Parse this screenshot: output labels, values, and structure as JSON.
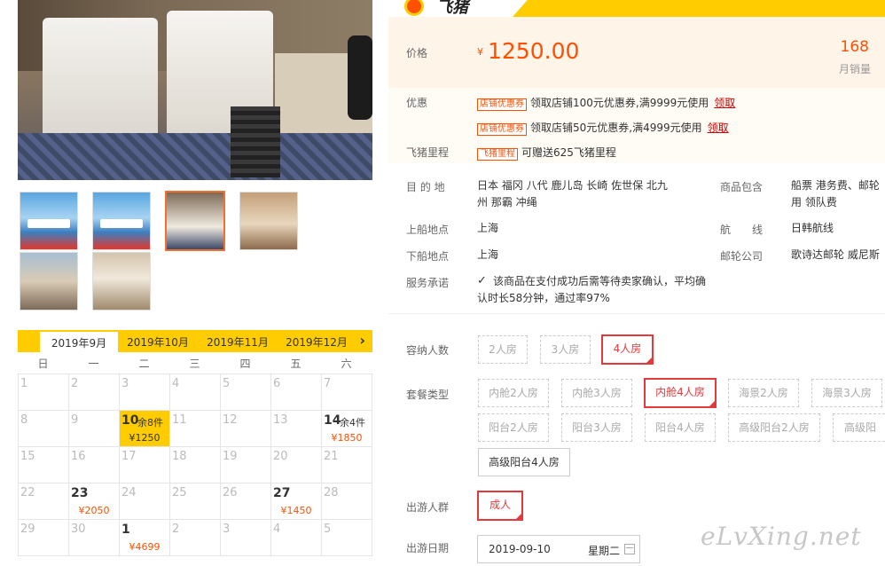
{
  "brand": {
    "name": "飞猪"
  },
  "gallery": {
    "thumbs": [
      {
        "banner": "上海出发  威尼斯号"
      },
      {
        "banner": "上海出发  威尼斯号"
      },
      {
        "banner": ""
      },
      {
        "banner": ""
      },
      {
        "banner": ""
      },
      {
        "banner": ""
      }
    ]
  },
  "calendar": {
    "months": [
      "2019年9月",
      "2019年10月",
      "2019年11月",
      "2019年12月"
    ],
    "active_month": "2019年9月",
    "weekdays": [
      "日",
      "一",
      "二",
      "三",
      "四",
      "五",
      "六"
    ],
    "weeks": [
      [
        {
          "d": "1"
        },
        {
          "d": "2"
        },
        {
          "d": "3"
        },
        {
          "d": "4"
        },
        {
          "d": "5"
        },
        {
          "d": "6"
        },
        {
          "d": "7"
        }
      ],
      [
        {
          "d": "8"
        },
        {
          "d": "9"
        },
        {
          "d": "10",
          "remain": "余8件",
          "price": "¥1250",
          "selected": true
        },
        {
          "d": "11"
        },
        {
          "d": "12"
        },
        {
          "d": "13"
        },
        {
          "d": "14",
          "remain": "余4件",
          "price": "¥1850"
        }
      ],
      [
        {
          "d": "15"
        },
        {
          "d": "16"
        },
        {
          "d": "17"
        },
        {
          "d": "18"
        },
        {
          "d": "19"
        },
        {
          "d": "20"
        },
        {
          "d": "21"
        }
      ],
      [
        {
          "d": "22"
        },
        {
          "d": "23",
          "price": "¥2050"
        },
        {
          "d": "24"
        },
        {
          "d": "25"
        },
        {
          "d": "26"
        },
        {
          "d": "27",
          "price": "¥1450"
        },
        {
          "d": "28"
        }
      ],
      [
        {
          "d": "29"
        },
        {
          "d": "30"
        },
        {
          "d": "1",
          "price": "¥4699"
        },
        {
          "d": "2"
        },
        {
          "d": "3"
        },
        {
          "d": "4"
        },
        {
          "d": "5"
        }
      ]
    ]
  },
  "price": {
    "label": "价格",
    "currency": "¥",
    "value": "1250.00",
    "sales_count": "168",
    "sales_label": "月销量"
  },
  "promo": {
    "label": "优惠",
    "items": [
      {
        "tag": "店铺优惠券",
        "text": "领取店铺100元优惠券,满9999元使用",
        "link": "领取"
      },
      {
        "tag": "店铺优惠券",
        "text": "领取店铺50元优惠券,满4999元使用",
        "link": "领取"
      }
    ],
    "mileage_label": "飞猪里程",
    "mileage_tag": "飞猪里程",
    "mileage_text": "可赠送625飞猪里程"
  },
  "info": {
    "destination_label": "目 的 地",
    "destination_line1": "日本  福冈  八代  鹿儿岛  长崎  佐世保  北九",
    "destination_line2": "州  那霸  冲绳",
    "includes_label": "商品包含",
    "includes_line1": "船票  港务费、邮轮",
    "includes_line2": "用  领队费",
    "board_label": "上船地点",
    "board_value": "上海",
    "route_label": "航　　线",
    "route_value": "日韩航线",
    "alight_label": "下船地点",
    "alight_value": "上海",
    "company_label": "邮轮公司",
    "company_value": "歌诗达邮轮  威尼斯",
    "service_label": "服务承诺",
    "service_line1": "该商品在支付成功后需等待卖家确认，平均确",
    "service_line2": "认时长58分钟，通过率97%"
  },
  "options": {
    "capacity_label": "容纳人数",
    "capacity": [
      "2人房",
      "3人房",
      "4人房"
    ],
    "package_label": "套餐类型",
    "packages": [
      "内舱2人房",
      "内舱3人房",
      "内舱4人房",
      "海景2人房",
      "海景3人房",
      "阳台2人房",
      "阳台3人房",
      "阳台4人房",
      "高级阳台2人房",
      "高级阳",
      "高级阳台4人房"
    ],
    "crowd_label": "出游人群",
    "crowd": [
      "成人"
    ],
    "date_label": "出游日期",
    "date_value": "2019-09-10",
    "date_weekday": "星期二"
  },
  "watermark": "eLvXing.net"
}
